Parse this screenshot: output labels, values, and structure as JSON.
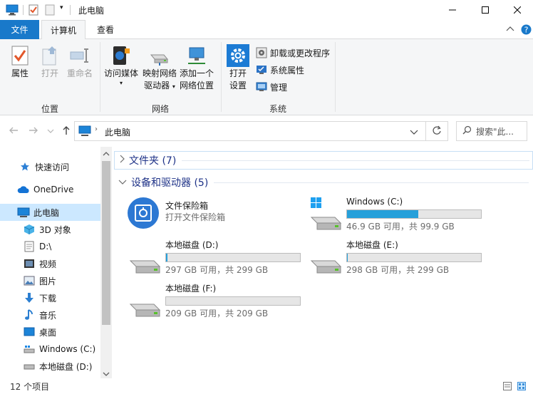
{
  "window": {
    "title": "此电脑"
  },
  "ribbon": {
    "tabs": [
      {
        "label": "文件"
      },
      {
        "label": "计算机"
      },
      {
        "label": "查看"
      }
    ],
    "groups": {
      "location": {
        "label": "位置",
        "buttons": [
          "属性",
          "打开",
          "重命名"
        ]
      },
      "network": {
        "label": "网络",
        "access_media": [
          "访问媒体"
        ],
        "map_drive": [
          "映射网络",
          "驱动器"
        ],
        "add_location": [
          "添加一个",
          "网络位置"
        ]
      },
      "system": {
        "label": "系统",
        "open_settings": [
          "打开",
          "设置"
        ],
        "small_buttons": [
          "卸载或更改程序",
          "系统属性",
          "管理"
        ]
      }
    }
  },
  "address": {
    "path": "此电脑",
    "search_placeholder": "搜索\"此..."
  },
  "nav": {
    "items": [
      {
        "label": "快速访问",
        "icon": "star-icon"
      },
      {
        "label": "OneDrive",
        "icon": "cloud-icon"
      },
      {
        "label": "此电脑",
        "icon": "computer-icon",
        "selected": true
      },
      {
        "label": "3D 对象",
        "icon": "cube-icon"
      },
      {
        "label": "D:\\",
        "icon": "document-icon"
      },
      {
        "label": "视频",
        "icon": "video-icon"
      },
      {
        "label": "图片",
        "icon": "picture-icon"
      },
      {
        "label": "下载",
        "icon": "download-icon"
      },
      {
        "label": "音乐",
        "icon": "music-icon"
      },
      {
        "label": "桌面",
        "icon": "desktop-icon"
      },
      {
        "label": "Windows (C:)",
        "icon": "drive-icon"
      },
      {
        "label": "本地磁盘 (D:)",
        "icon": "drive-icon"
      }
    ]
  },
  "content": {
    "folders_section": "文件夹 (7)",
    "devices_section": "设备和驱动器 (5)",
    "vault": {
      "name": "文件保险箱",
      "subtitle": "打开文件保险箱"
    },
    "drives": [
      {
        "name": "Windows (C:)",
        "info": "46.9 GB 可用，共 99.9 GB",
        "used_fraction": 0.53
      },
      {
        "name": "本地磁盘 (D:)",
        "info": "297 GB 可用，共 299 GB",
        "used_fraction": 0.01
      },
      {
        "name": "本地磁盘 (E:)",
        "info": "298 GB 可用，共 299 GB",
        "used_fraction": 0.003
      },
      {
        "name": "本地磁盘 (F:)",
        "info": "209 GB 可用，共 209 GB",
        "used_fraction": 0.0
      }
    ]
  },
  "status": {
    "count": "12 个项目"
  },
  "colors": {
    "accent": "#1979ca",
    "bar_fill": "#26a0da",
    "section_header": "#1e3287",
    "selected_bg": "#cce8ff"
  }
}
